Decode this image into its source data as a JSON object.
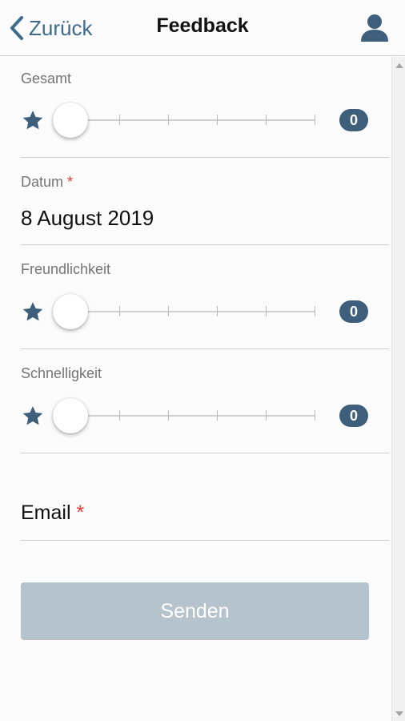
{
  "header": {
    "back_label": "Zurück",
    "title": "Feedback"
  },
  "form": {
    "overall": {
      "label": "Gesamt",
      "value": "0"
    },
    "date": {
      "label": "Datum",
      "required_mark": "*",
      "value": "8 August 2019"
    },
    "friendliness": {
      "label": "Freundlichkeit",
      "value": "0"
    },
    "speed": {
      "label": "Schnelligkeit",
      "value": "0"
    },
    "email": {
      "label": "Email",
      "required_mark": "*"
    },
    "submit_label": "Senden"
  },
  "colors": {
    "accent": "#3e6a8c",
    "badge": "#3e5f7b",
    "required": "#e53935",
    "button_disabled": "#b5c3cc"
  },
  "icons": {
    "back": "chevron-left-icon",
    "user": "user-icon",
    "rating": "star-icon"
  }
}
